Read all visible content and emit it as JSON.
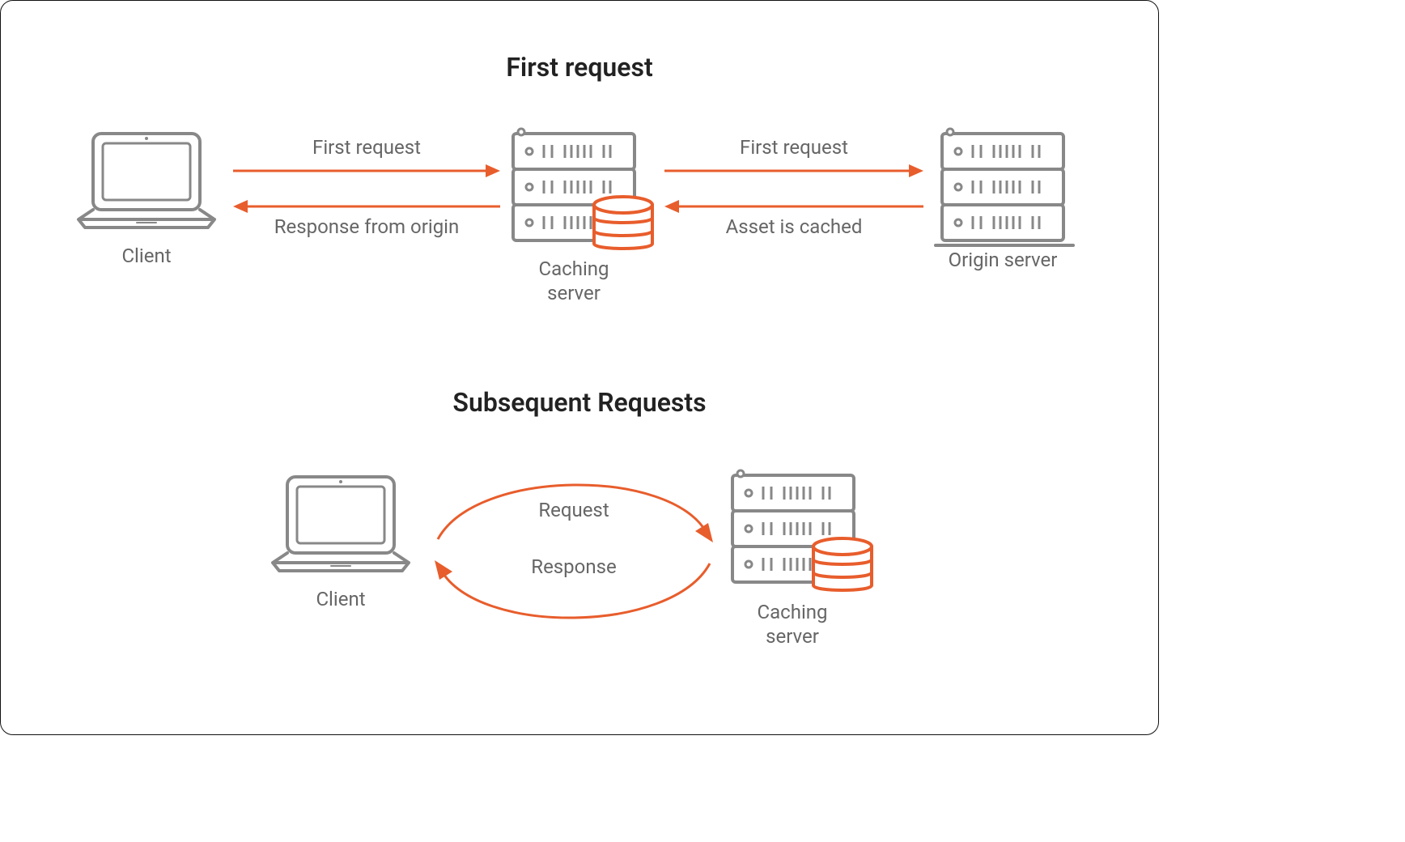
{
  "section1": {
    "title": "First request",
    "client_label": "Client",
    "caching_label": "Caching\nserver",
    "origin_label": "Origin server",
    "arrow_cc_top": "First request",
    "arrow_cc_bottom": "Response from origin",
    "arrow_co_top": "First request",
    "arrow_co_bottom": "Asset is cached"
  },
  "section2": {
    "title": "Subsequent Requests",
    "client_label": "Client",
    "caching_label": "Caching\nserver",
    "arrow_top": "Request",
    "arrow_bottom": "Response"
  }
}
